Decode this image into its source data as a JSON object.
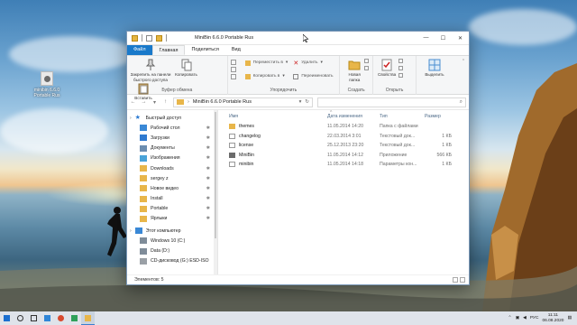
{
  "desktop": {
    "icon_label": "minibin 6.6.0 Portable Rus"
  },
  "window": {
    "title": "MiniBin 6.6.0 Portable Rus",
    "controls": {
      "minimize": "—",
      "maximize": "☐",
      "close": "✕"
    },
    "tabs": [
      "Файл",
      "Главная",
      "Поделиться",
      "Вид"
    ],
    "ribbon": {
      "clipboard": {
        "pin_label": "Закрепить на панели быстрого доступа",
        "copy_label": "Копировать",
        "paste_label": "Вставить",
        "group_label": "Буфер обмена"
      },
      "organize": {
        "move_label": "Переместить в",
        "copy_to_label": "Копировать в",
        "delete_label": "Удалить",
        "rename_label": "Переименовать",
        "group_label": "Упорядочить"
      },
      "create": {
        "new_folder_label": "Новая папка",
        "group_label": "Создать"
      },
      "open": {
        "properties_label": "Свойства",
        "group_label": "Открыть"
      },
      "select": {
        "select_label": "Выделить"
      }
    },
    "address": {
      "path": "MiniBin 6.6.0 Portable Rus",
      "refresh": "↻"
    },
    "nav": {
      "quick_access": "Быстрый доступ",
      "items": [
        {
          "label": "Рабочий стол",
          "pinned": true
        },
        {
          "label": "Загрузки",
          "pinned": true
        },
        {
          "label": "Документы",
          "pinned": true
        },
        {
          "label": "Изображения",
          "pinned": true
        },
        {
          "label": "Downloads",
          "pinned": true
        },
        {
          "label": "sergey z",
          "pinned": true
        },
        {
          "label": "Новое видео",
          "pinned": true
        },
        {
          "label": "Install",
          "pinned": true
        },
        {
          "label": "Portable",
          "pinned": true
        },
        {
          "label": "Ярлыки",
          "pinned": true
        }
      ],
      "this_pc": "Этот компьютер",
      "drives": [
        "Windows 10 (C:)",
        "Data (D:)",
        "CD-дисковод (G:) ESD-ISO"
      ]
    },
    "columns": {
      "name": "Имя",
      "date": "Дата изменения",
      "type": "Тип",
      "size": "Размер"
    },
    "files": [
      {
        "name": "themes",
        "date": "11.05.2014 14:20",
        "type": "Папка с файлами",
        "size": ""
      },
      {
        "name": "changelog",
        "date": "22.03.2014 3:01",
        "type": "Текстовый док...",
        "size": "1 КБ"
      },
      {
        "name": "license",
        "date": "25.12.2013 23:20",
        "type": "Текстовый док...",
        "size": "1 КБ"
      },
      {
        "name": "MiniBin",
        "date": "11.05.2014 14:12",
        "type": "Приложение",
        "size": "566 КБ"
      },
      {
        "name": "minibin",
        "date": "11.05.2014 14:18",
        "type": "Параметры кон...",
        "size": "1 КБ"
      }
    ],
    "status": "Элементов: 5"
  },
  "taskbar": {
    "lang": "РУС",
    "time": "11:11",
    "date": "06.08.2020"
  },
  "colors": {
    "accent": "#1979ca",
    "folder": "#e8b64a",
    "selection": "#cce8ff"
  }
}
